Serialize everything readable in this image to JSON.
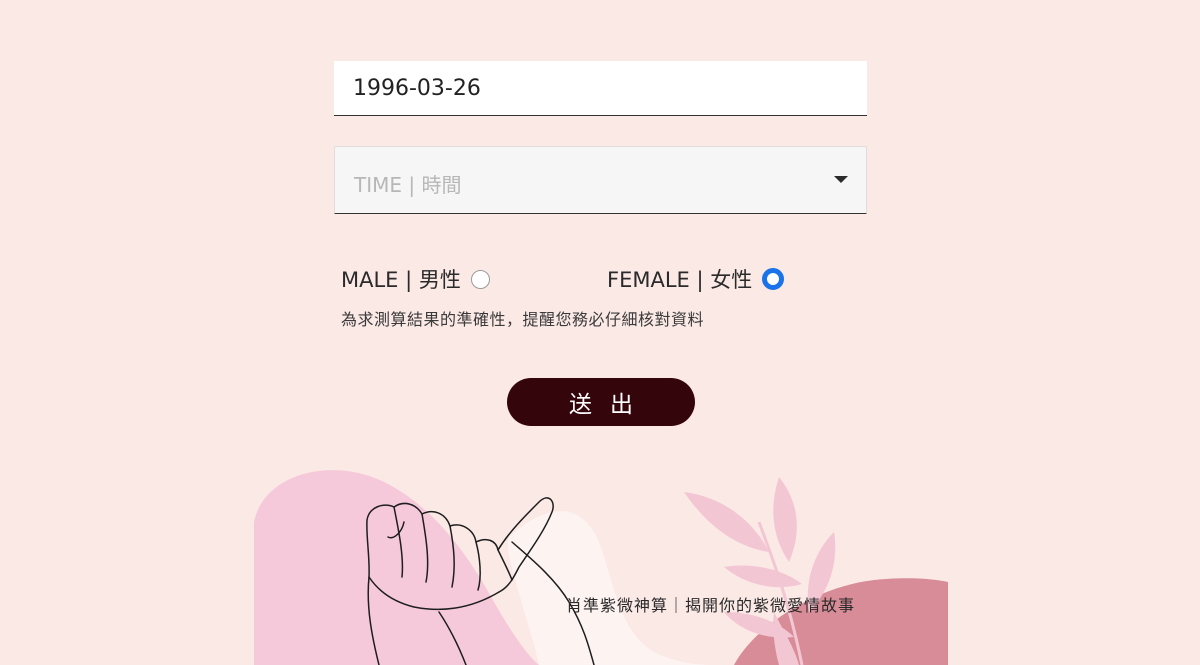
{
  "form": {
    "date_value": "1996-03-26",
    "time_placeholder": "TIME | 時間",
    "male_label": "MALE | 男性",
    "female_label": "FEMALE | 女性",
    "selected_gender": "female",
    "hint": "為求測算結果的準確性，提醒您務必仔細核對資料",
    "submit_label": "送出"
  },
  "banner": {
    "tagline": "肖準紫微神算｜揭開你的紫微愛情故事"
  },
  "colors": {
    "background": "#fbe9e6",
    "submit_bg": "#35050c",
    "radio_accent": "#1a73e8",
    "blob_pink": "#f4c9d8",
    "blob_rose": "#d78b96"
  }
}
